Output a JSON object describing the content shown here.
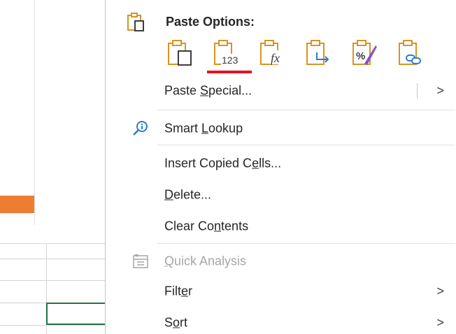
{
  "sheet": {
    "chart_bar_color": "#ed7d31",
    "selection_color": "#217346"
  },
  "context_menu": {
    "paste_options": {
      "header_label": "Paste Options:",
      "header_icon": "clipboard-icon",
      "options": [
        {
          "name": "paste-icon",
          "label": "Paste"
        },
        {
          "name": "paste-values-icon",
          "label": "Values",
          "badge_text": "123",
          "selected": true
        },
        {
          "name": "paste-formulas-icon",
          "label": "Formulas",
          "badge_text": "fx"
        },
        {
          "name": "paste-transpose-icon",
          "label": "Transpose"
        },
        {
          "name": "paste-formatting-icon",
          "label": "Formatting",
          "badge_text": "%"
        },
        {
          "name": "paste-link-icon",
          "label": "Paste Link"
        }
      ]
    },
    "items": {
      "paste_special": {
        "pre": "Paste ",
        "acc": "S",
        "post": "pecial...",
        "has_submenu": true,
        "arrow": ">"
      },
      "smart_lookup": {
        "pre": "Smart ",
        "acc": "L",
        "post": "ookup",
        "icon": "search-icon"
      },
      "insert_copied_cells": {
        "pre": "Insert Copied C",
        "acc": "e",
        "post": "lls..."
      },
      "delete": {
        "pre": "",
        "acc": "D",
        "post": "elete..."
      },
      "clear_contents": {
        "pre": "Clear Co",
        "acc": "n",
        "post": "tents"
      },
      "quick_analysis": {
        "pre": "",
        "acc": "Q",
        "post": "uick Analysis",
        "disabled": true,
        "icon": "quick-analysis-icon"
      },
      "filter": {
        "pre": "Filt",
        "acc": "e",
        "post": "r",
        "has_submenu": true,
        "arrow": ">"
      },
      "sort": {
        "pre": "S",
        "acc": "o",
        "post": "rt",
        "has_submenu": true,
        "arrow": ">"
      }
    },
    "colors": {
      "accent": "#d79422",
      "link_blue": "#2b7cd3",
      "active_underline": "#e81123"
    }
  }
}
